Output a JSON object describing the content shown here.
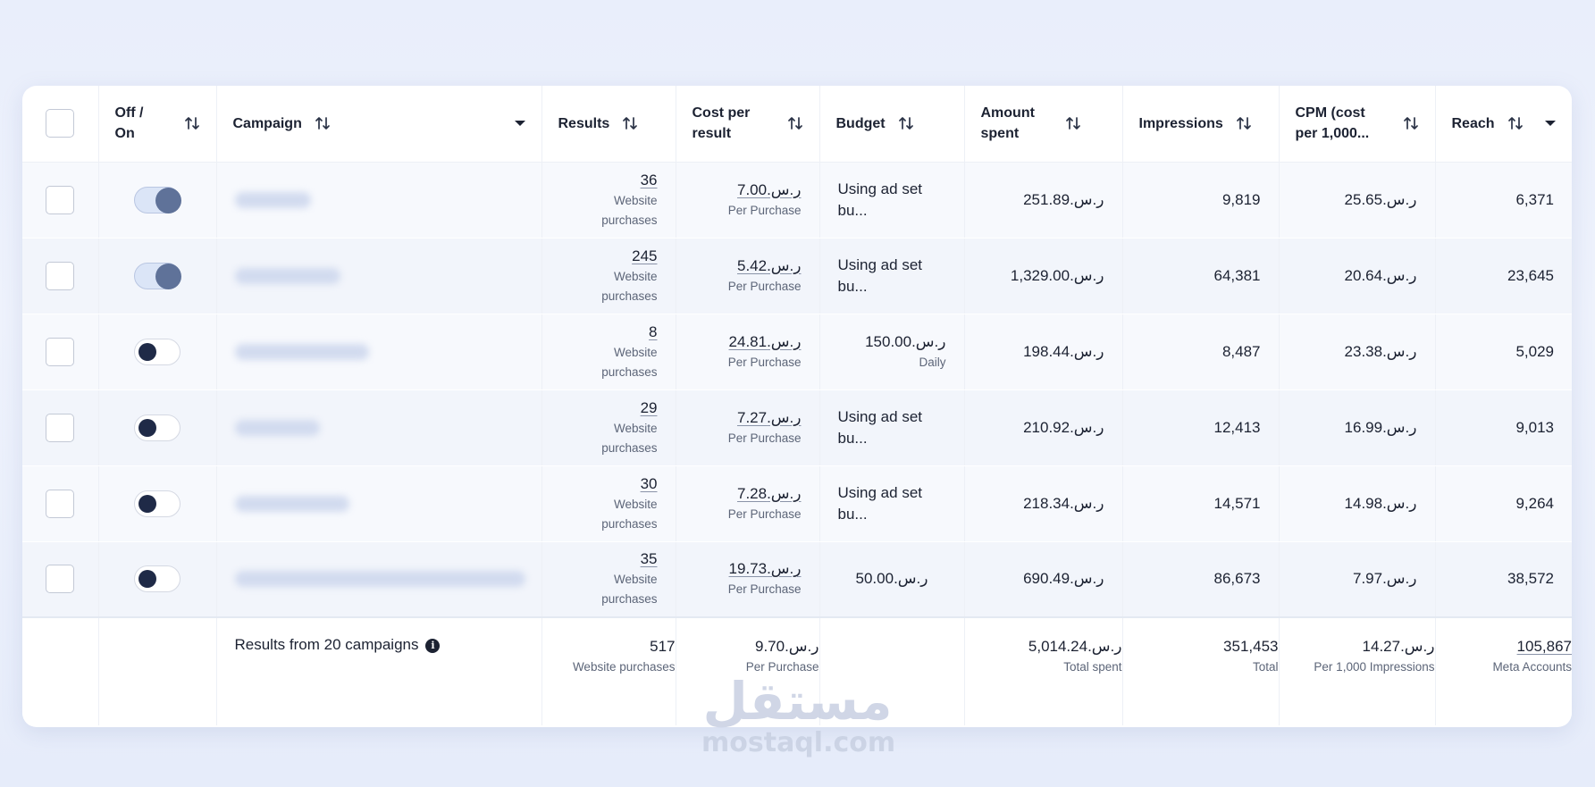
{
  "table": {
    "headers": {
      "off_on": "Off / On",
      "campaign": "Campaign",
      "results": "Results",
      "cost_per_result": "Cost per result",
      "budget": "Budget",
      "amount_spent": "Amount spent",
      "impressions": "Impressions",
      "cpm": "CPM (cost per 1,000...",
      "reach": "Reach"
    },
    "rows": [
      {
        "toggle": "on",
        "results": "36",
        "results_sub": "Website purchases",
        "cost": "ر.س.7.00",
        "cost_sub": "Per Purchase",
        "budget": "Using ad set bu...",
        "budget_sub": "",
        "spent": "ر.س.251.89",
        "impressions": "9,819",
        "cpm": "ر.س.25.65",
        "reach": "6,371"
      },
      {
        "toggle": "on",
        "results": "245",
        "results_sub": "Website purchases",
        "cost": "ر.س.5.42",
        "cost_sub": "Per Purchase",
        "budget": "Using ad set bu...",
        "budget_sub": "",
        "spent": "ر.س.1,329.00",
        "impressions": "64,381",
        "cpm": "ر.س.20.64",
        "reach": "23,645"
      },
      {
        "toggle": "off",
        "results": "8",
        "results_sub": "Website purchases",
        "cost": "ر.س.24.81",
        "cost_sub": "Per Purchase",
        "budget": "ر.س.150.00",
        "budget_sub": "Daily",
        "spent": "ر.س.198.44",
        "impressions": "8,487",
        "cpm": "ر.س.23.38",
        "reach": "5,029"
      },
      {
        "toggle": "off",
        "results": "29",
        "results_sub": "Website purchases",
        "cost": "ر.س.7.27",
        "cost_sub": "Per Purchase",
        "budget": "Using ad set bu...",
        "budget_sub": "",
        "spent": "ر.س.210.92",
        "impressions": "12,413",
        "cpm": "ر.س.16.99",
        "reach": "9,013"
      },
      {
        "toggle": "off",
        "results": "30",
        "results_sub": "Website purchases",
        "cost": "ر.س.7.28",
        "cost_sub": "Per Purchase",
        "budget": "Using ad set bu...",
        "budget_sub": "",
        "spent": "ر.س.218.34",
        "impressions": "14,571",
        "cpm": "ر.س.14.98",
        "reach": "9,264"
      },
      {
        "toggle": "off",
        "results": "35",
        "results_sub": "Website purchases",
        "cost": "ر.س.19.73",
        "cost_sub": "Per Purchase",
        "budget": "ر.س.50.00",
        "budget_sub": "",
        "spent": "ر.س.690.49",
        "impressions": "86,673",
        "cpm": "ر.س.7.97",
        "reach": "38,572"
      }
    ],
    "footer": {
      "label": "Results from 20 campaigns",
      "results": "517",
      "results_sub": "Website purchases",
      "cost": "ر.س.9.70",
      "cost_sub": "Per Purchase",
      "spent": "ر.س.5,014.24",
      "spent_sub": "Total spent",
      "impressions": "351,453",
      "impressions_sub": "Total",
      "cpm": "ر.س.14.27",
      "cpm_sub": "Per 1,000 Impressions",
      "reach": "105,867",
      "reach_sub": "Meta Accounts"
    }
  },
  "watermark": {
    "logo": "مستقل",
    "url": "mostaql.com"
  },
  "colors": {
    "toggle_on_knob": "#5f7299",
    "toggle_off_knob": "#1f2a47",
    "text": "#1c2232",
    "subtext": "#5c6578"
  }
}
